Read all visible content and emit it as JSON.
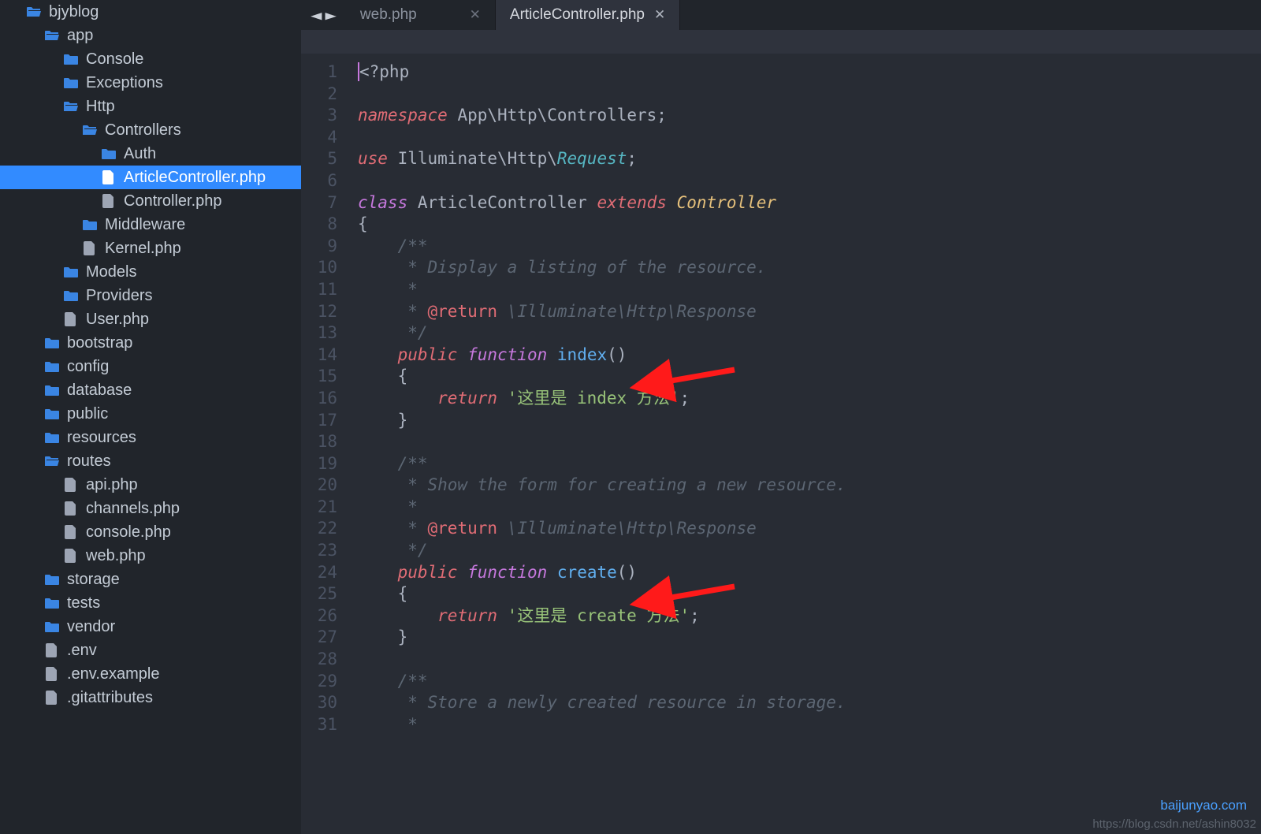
{
  "watermarks": {
    "top": "baijunyao.com",
    "bottom": "https://blog.csdn.net/ashin8032"
  },
  "sidebar": {
    "items": [
      {
        "label": "bjyblog",
        "type": "folder-open",
        "indent": 32,
        "selected": false
      },
      {
        "label": "app",
        "type": "folder-open",
        "indent": 55,
        "selected": false
      },
      {
        "label": "Console",
        "type": "folder",
        "indent": 79,
        "selected": false
      },
      {
        "label": "Exceptions",
        "type": "folder",
        "indent": 79,
        "selected": false
      },
      {
        "label": "Http",
        "type": "folder-open",
        "indent": 79,
        "selected": false
      },
      {
        "label": "Controllers",
        "type": "folder-open",
        "indent": 103,
        "selected": false
      },
      {
        "label": "Auth",
        "type": "folder",
        "indent": 127,
        "selected": false
      },
      {
        "label": "ArticleController.php",
        "type": "file",
        "indent": 127,
        "selected": true
      },
      {
        "label": "Controller.php",
        "type": "file",
        "indent": 127,
        "selected": false
      },
      {
        "label": "Middleware",
        "type": "folder",
        "indent": 103,
        "selected": false
      },
      {
        "label": "Kernel.php",
        "type": "file",
        "indent": 103,
        "selected": false
      },
      {
        "label": "Models",
        "type": "folder",
        "indent": 79,
        "selected": false
      },
      {
        "label": "Providers",
        "type": "folder",
        "indent": 79,
        "selected": false
      },
      {
        "label": "User.php",
        "type": "file",
        "indent": 79,
        "selected": false
      },
      {
        "label": "bootstrap",
        "type": "folder",
        "indent": 55,
        "selected": false
      },
      {
        "label": "config",
        "type": "folder",
        "indent": 55,
        "selected": false
      },
      {
        "label": "database",
        "type": "folder",
        "indent": 55,
        "selected": false
      },
      {
        "label": "public",
        "type": "folder",
        "indent": 55,
        "selected": false
      },
      {
        "label": "resources",
        "type": "folder",
        "indent": 55,
        "selected": false
      },
      {
        "label": "routes",
        "type": "folder-open",
        "indent": 55,
        "selected": false
      },
      {
        "label": "api.php",
        "type": "file",
        "indent": 79,
        "selected": false
      },
      {
        "label": "channels.php",
        "type": "file",
        "indent": 79,
        "selected": false
      },
      {
        "label": "console.php",
        "type": "file",
        "indent": 79,
        "selected": false
      },
      {
        "label": "web.php",
        "type": "file",
        "indent": 79,
        "selected": false
      },
      {
        "label": "storage",
        "type": "folder",
        "indent": 55,
        "selected": false
      },
      {
        "label": "tests",
        "type": "folder",
        "indent": 55,
        "selected": false
      },
      {
        "label": "vendor",
        "type": "folder",
        "indent": 55,
        "selected": false
      },
      {
        "label": ".env",
        "type": "file",
        "indent": 55,
        "selected": false
      },
      {
        "label": ".env.example",
        "type": "file",
        "indent": 55,
        "selected": false
      },
      {
        "label": ".gitattributes",
        "type": "file",
        "indent": 55,
        "selected": false
      }
    ]
  },
  "tabs": [
    {
      "label": "web.php",
      "active": false
    },
    {
      "label": "ArticleController.php",
      "active": true
    }
  ],
  "code": {
    "line_count": 31,
    "lines": [
      [
        {
          "cls": "cursor",
          "t": ""
        },
        {
          "cls": "",
          "t": "<?php"
        }
      ],
      [
        {
          "cls": "",
          "t": ""
        }
      ],
      [
        {
          "cls": "kw-red",
          "t": "namespace"
        },
        {
          "cls": "",
          "t": " App\\Http\\Controllers;"
        }
      ],
      [
        {
          "cls": "",
          "t": ""
        }
      ],
      [
        {
          "cls": "kw-red",
          "t": "use"
        },
        {
          "cls": "",
          "t": " Illuminate\\Http\\"
        },
        {
          "cls": "kw-teal",
          "t": "Request"
        },
        {
          "cls": "",
          "t": ";"
        }
      ],
      [
        {
          "cls": "",
          "t": ""
        }
      ],
      [
        {
          "cls": "kw-purple",
          "t": "class"
        },
        {
          "cls": "",
          "t": " ArticleController "
        },
        {
          "cls": "kw-red",
          "t": "extends"
        },
        {
          "cls": "",
          "t": " "
        },
        {
          "cls": "kw-yellow",
          "t": "Controller"
        }
      ],
      [
        {
          "cls": "",
          "t": "{"
        }
      ],
      [
        {
          "cls": "kw-gray",
          "t": "    /**"
        }
      ],
      [
        {
          "cls": "kw-gray",
          "t": "     * Display a listing of the resource."
        }
      ],
      [
        {
          "cls": "kw-gray",
          "t": "     *"
        }
      ],
      [
        {
          "cls": "kw-gray",
          "t": "     * "
        },
        {
          "cls": "kw-red-b",
          "t": "@return"
        },
        {
          "cls": "kw-gray",
          "t": " \\Illuminate\\Http\\Response"
        }
      ],
      [
        {
          "cls": "kw-gray",
          "t": "     */"
        }
      ],
      [
        {
          "cls": "",
          "t": "    "
        },
        {
          "cls": "kw-red",
          "t": "public"
        },
        {
          "cls": "",
          "t": " "
        },
        {
          "cls": "kw-purple",
          "t": "function"
        },
        {
          "cls": "",
          "t": " "
        },
        {
          "cls": "kw-blue",
          "t": "index"
        },
        {
          "cls": "",
          "t": "()"
        }
      ],
      [
        {
          "cls": "",
          "t": "    {"
        }
      ],
      [
        {
          "cls": "",
          "t": "        "
        },
        {
          "cls": "kw-red",
          "t": "return"
        },
        {
          "cls": "",
          "t": " "
        },
        {
          "cls": "kw-green",
          "t": "'这里是 index 方法'"
        },
        {
          "cls": "",
          "t": ";"
        }
      ],
      [
        {
          "cls": "",
          "t": "    }"
        }
      ],
      [
        {
          "cls": "",
          "t": ""
        }
      ],
      [
        {
          "cls": "kw-gray",
          "t": "    /**"
        }
      ],
      [
        {
          "cls": "kw-gray",
          "t": "     * Show the form for creating a new resource."
        }
      ],
      [
        {
          "cls": "kw-gray",
          "t": "     *"
        }
      ],
      [
        {
          "cls": "kw-gray",
          "t": "     * "
        },
        {
          "cls": "kw-red-b",
          "t": "@return"
        },
        {
          "cls": "kw-gray",
          "t": " \\Illuminate\\Http\\Response"
        }
      ],
      [
        {
          "cls": "kw-gray",
          "t": "     */"
        }
      ],
      [
        {
          "cls": "",
          "t": "    "
        },
        {
          "cls": "kw-red",
          "t": "public"
        },
        {
          "cls": "",
          "t": " "
        },
        {
          "cls": "kw-purple",
          "t": "function"
        },
        {
          "cls": "",
          "t": " "
        },
        {
          "cls": "kw-blue",
          "t": "create"
        },
        {
          "cls": "",
          "t": "()"
        }
      ],
      [
        {
          "cls": "",
          "t": "    {"
        }
      ],
      [
        {
          "cls": "",
          "t": "        "
        },
        {
          "cls": "kw-red",
          "t": "return"
        },
        {
          "cls": "",
          "t": " "
        },
        {
          "cls": "kw-green",
          "t": "'这里是 create 方法'"
        },
        {
          "cls": "",
          "t": ";"
        }
      ],
      [
        {
          "cls": "",
          "t": "    }"
        }
      ],
      [
        {
          "cls": "",
          "t": ""
        }
      ],
      [
        {
          "cls": "kw-gray",
          "t": "    /**"
        }
      ],
      [
        {
          "cls": "kw-gray",
          "t": "     * Store a newly created resource in storage."
        }
      ],
      [
        {
          "cls": "kw-gray",
          "t": "     *"
        }
      ]
    ]
  }
}
